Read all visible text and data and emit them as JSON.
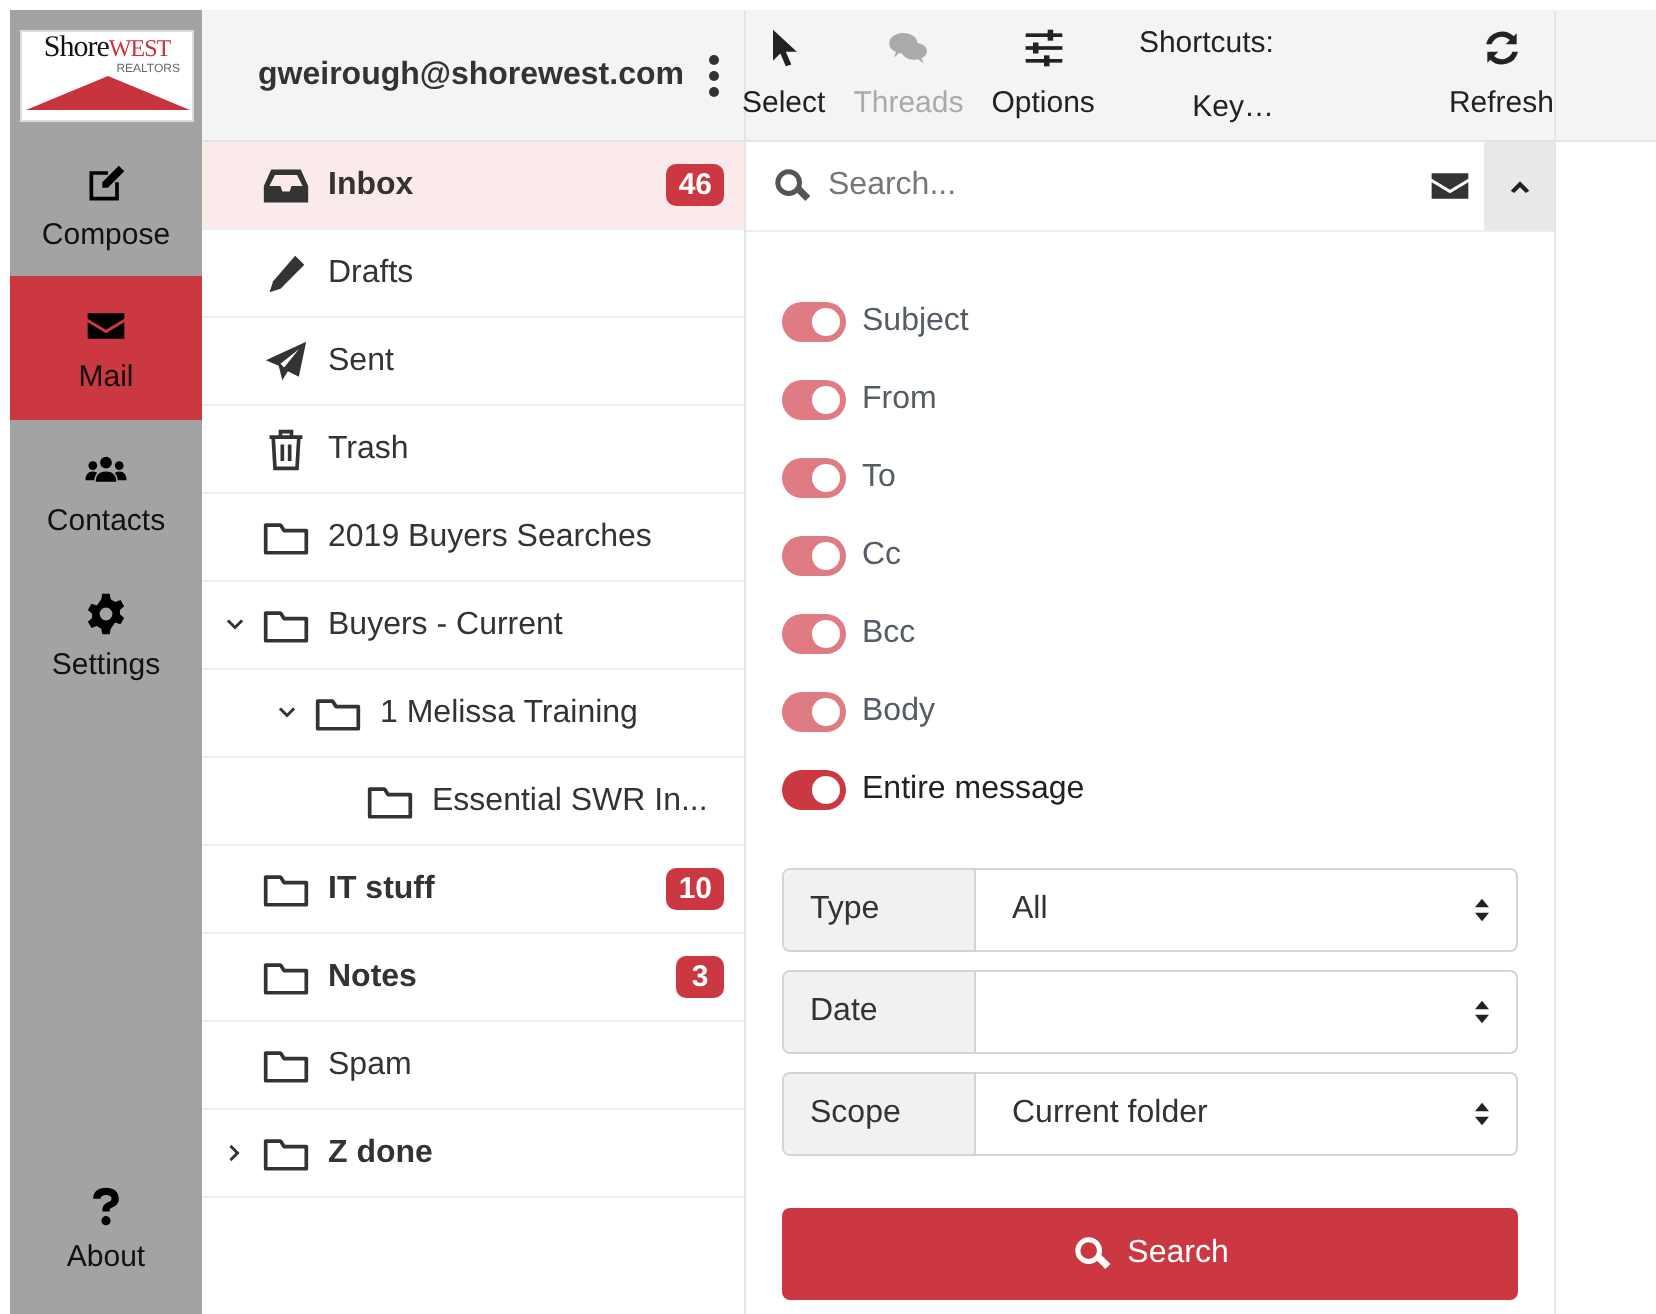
{
  "logo": {
    "word_a": "Shore",
    "word_b": "WEST",
    "tagline": "REALTORS"
  },
  "rail": [
    {
      "label": "Compose",
      "kind": "compose",
      "selected": false
    },
    {
      "label": "Mail",
      "kind": "mail",
      "selected": true
    },
    {
      "label": "Contacts",
      "kind": "contacts",
      "selected": false
    },
    {
      "label": "Settings",
      "kind": "settings",
      "selected": false
    }
  ],
  "rail_bottom": {
    "label": "About"
  },
  "account": {
    "email": "gweirough@shorewest.com"
  },
  "toolbar": [
    {
      "label": "Select",
      "kind": "select",
      "disabled": false
    },
    {
      "label": "Threads",
      "kind": "threads",
      "disabled": true
    },
    {
      "label": "Options",
      "kind": "options",
      "disabled": false
    }
  ],
  "shortcuts": {
    "label": "Shortcuts:",
    "button": "Key…"
  },
  "refresh": {
    "label": "Refresh"
  },
  "folders": [
    {
      "name": "Inbox",
      "kind": "inbox",
      "selected": true,
      "unread": true,
      "badge": "46"
    },
    {
      "name": "Drafts",
      "kind": "drafts",
      "selected": false,
      "unread": false
    },
    {
      "name": "Sent",
      "kind": "sent",
      "selected": false,
      "unread": false
    },
    {
      "name": "Trash",
      "kind": "trash",
      "selected": false,
      "unread": false
    },
    {
      "name": "2019 Buyers Searches",
      "kind": "folder",
      "selected": false,
      "unread": false
    },
    {
      "name": "Buyers - Current",
      "kind": "folder",
      "selected": false,
      "unread": false,
      "expanded": true,
      "children": [
        {
          "name": "1 Melissa Training",
          "kind": "folder",
          "selected": false,
          "unread": false,
          "expanded": true,
          "children": [
            {
              "name": "Essential SWR In...",
              "kind": "folder",
              "selected": false,
              "unread": false
            }
          ]
        }
      ]
    },
    {
      "name": "IT stuff",
      "kind": "folder",
      "selected": false,
      "unread": true,
      "badge": "10"
    },
    {
      "name": "Notes",
      "kind": "folder",
      "selected": false,
      "unread": true,
      "badge": "3"
    },
    {
      "name": "Spam",
      "kind": "folder",
      "selected": false,
      "unread": false
    },
    {
      "name": "Z done",
      "kind": "folder",
      "selected": false,
      "unread": true,
      "expanded": false
    }
  ],
  "search": {
    "placeholder": "Search..."
  },
  "search_fields": [
    {
      "label": "Subject",
      "on": true,
      "disabled": true
    },
    {
      "label": "From",
      "on": true,
      "disabled": true
    },
    {
      "label": "To",
      "on": true,
      "disabled": true
    },
    {
      "label": "Cc",
      "on": true,
      "disabled": true
    },
    {
      "label": "Bcc",
      "on": true,
      "disabled": true
    },
    {
      "label": "Body",
      "on": true,
      "disabled": true
    },
    {
      "label": "Entire message",
      "on": true,
      "disabled": false
    }
  ],
  "filters": [
    {
      "label": "Type",
      "value": "All"
    },
    {
      "label": "Date"
    },
    {
      "label": "Scope",
      "value": "Current folder"
    }
  ],
  "search_button": {
    "label": "Search"
  }
}
